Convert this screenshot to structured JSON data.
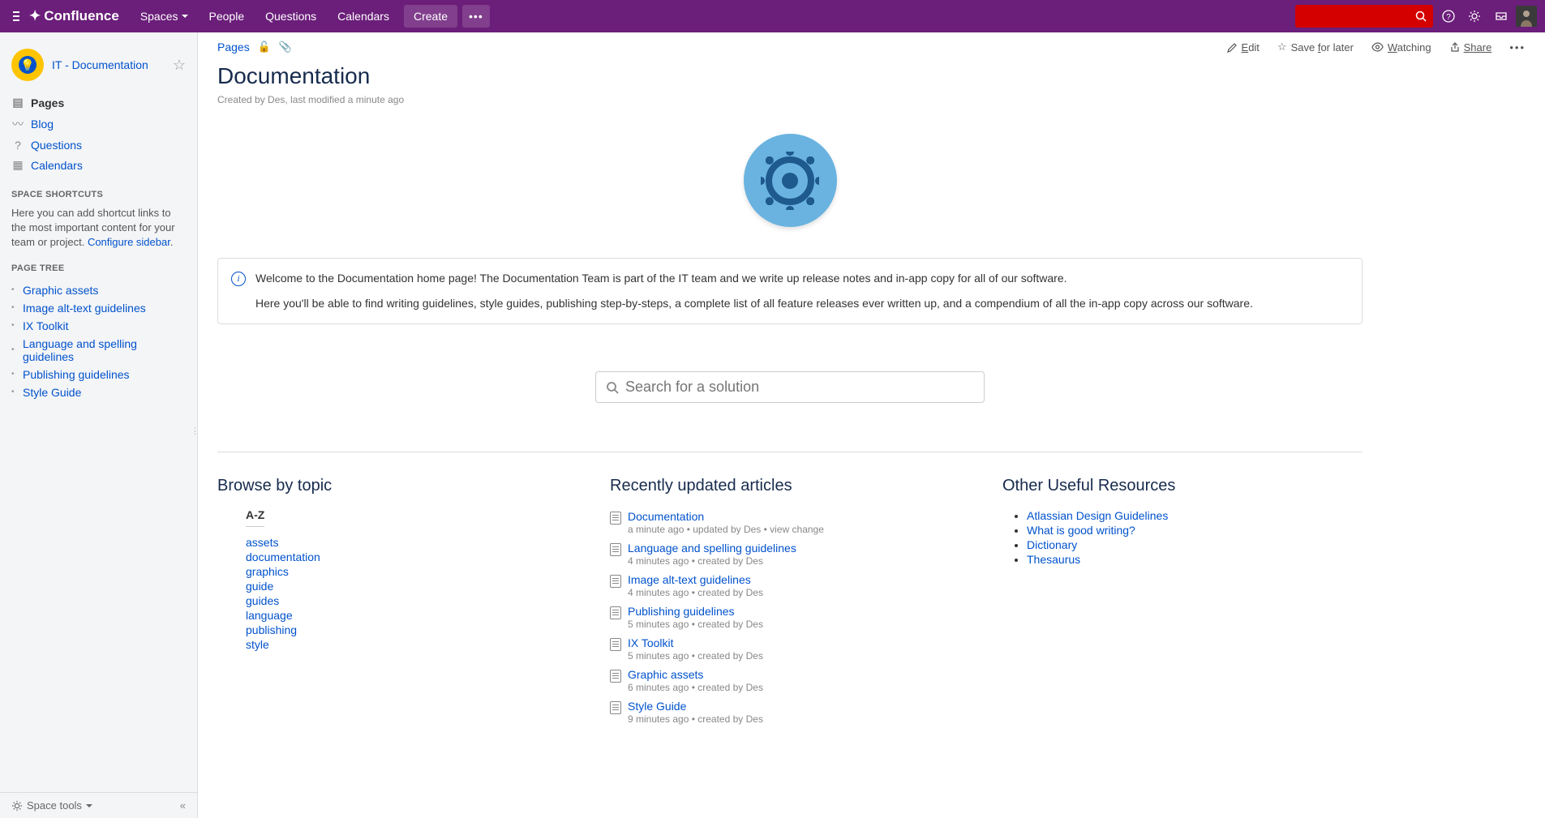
{
  "header": {
    "logo": "Confluence",
    "nav": {
      "spaces": "Spaces",
      "people": "People",
      "questions": "Questions",
      "calendars": "Calendars"
    },
    "create": "Create",
    "more": "•••"
  },
  "sidebar": {
    "space_title": "IT - Documentation",
    "nav": {
      "pages": "Pages",
      "blog": "Blog",
      "questions": "Questions",
      "calendars": "Calendars"
    },
    "shortcuts_heading": "SPACE SHORTCUTS",
    "shortcuts_text": "Here you can add shortcut links to the most important content for your team or project. ",
    "shortcuts_link": "Configure sidebar",
    "tree_heading": "PAGE TREE",
    "tree": [
      "Graphic assets",
      "Image alt-text guidelines",
      "IX Toolkit",
      "Language and spelling guidelines",
      "Publishing guidelines",
      "Style Guide"
    ],
    "footer": {
      "space_tools": "Space tools",
      "collapse": "«"
    }
  },
  "breadcrumbs": {
    "pages": "Pages"
  },
  "actions": {
    "edit": "Edit",
    "save": "Save for later",
    "watch": "Watching",
    "share": "Share"
  },
  "page": {
    "title": "Documentation",
    "meta": "Created by Des, last modified a minute ago"
  },
  "info": {
    "p1": "Welcome to the Documentation home page! The Documentation Team is part of the IT team and we write up release notes and in-app copy for all of our software.",
    "p2": "Here you'll be able to find writing guidelines, style guides, publishing step-by-steps, a complete list of all feature releases ever written up, and a compendium of all the in-app copy across our software."
  },
  "search": {
    "placeholder": "Search for a solution"
  },
  "browse": {
    "heading": "Browse by topic",
    "az": "A-Z",
    "topics": [
      "assets",
      "documentation",
      "graphics",
      "guide",
      "guides",
      "language",
      "publishing",
      "style"
    ]
  },
  "recent": {
    "heading": "Recently updated articles",
    "items": [
      {
        "title": "Documentation",
        "meta": "a minute ago • updated by Des • view change"
      },
      {
        "title": "Language and spelling guidelines",
        "meta": "4 minutes ago • created by Des"
      },
      {
        "title": "Image alt-text guidelines",
        "meta": "4 minutes ago • created by Des"
      },
      {
        "title": "Publishing guidelines",
        "meta": "5 minutes ago • created by Des"
      },
      {
        "title": "IX Toolkit",
        "meta": "5 minutes ago • created by Des"
      },
      {
        "title": "Graphic assets",
        "meta": "6 minutes ago • created by Des"
      },
      {
        "title": "Style Guide",
        "meta": "9 minutes ago • created by Des"
      }
    ]
  },
  "resources": {
    "heading": "Other Useful Resources",
    "items": [
      "Atlassian Design Guidelines",
      "What is good writing?",
      "Dictionary",
      "Thesaurus"
    ]
  }
}
